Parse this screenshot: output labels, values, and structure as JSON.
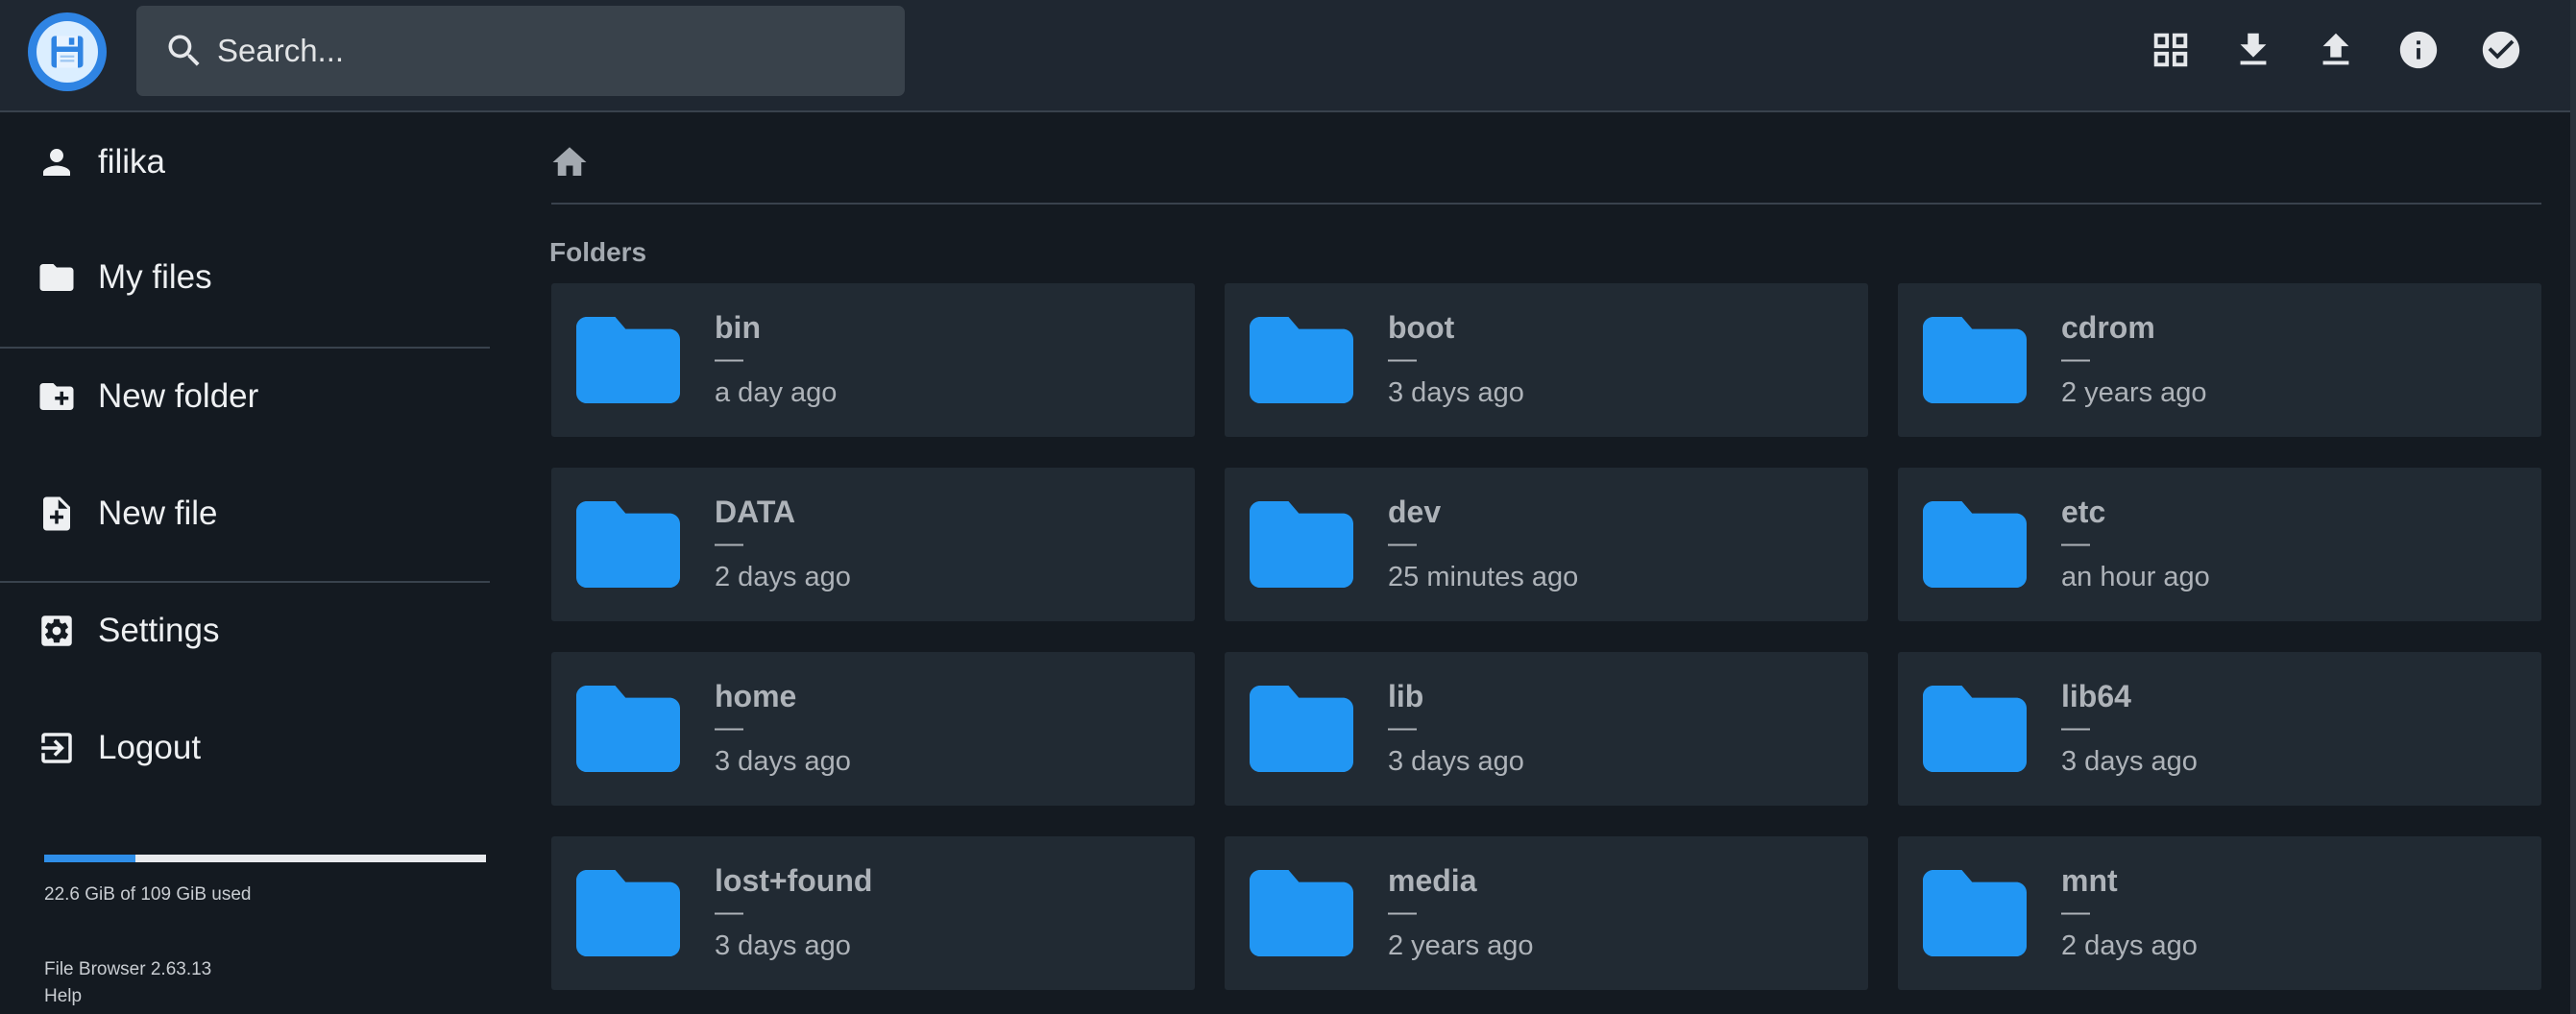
{
  "app": {
    "logo_icon": "floppy-disk-icon"
  },
  "search": {
    "placeholder": "Search..."
  },
  "header_actions": [
    {
      "name": "grid-view-icon",
      "label": "Switch view"
    },
    {
      "name": "download-icon",
      "label": "Download"
    },
    {
      "name": "upload-icon",
      "label": "Upload"
    },
    {
      "name": "info-icon",
      "label": "Info"
    },
    {
      "name": "select-check-icon",
      "label": "Select multiple"
    }
  ],
  "sidebar": {
    "user": "filika",
    "my_files": "My files",
    "new_folder": "New folder",
    "new_file": "New file",
    "settings": "Settings",
    "logout": "Logout",
    "usage_text": "22.6 GiB of 109 GiB used",
    "usage_fraction": 0.207,
    "version": "File Browser 2.63.13",
    "help": "Help"
  },
  "main": {
    "section_title": "Folders",
    "folders": [
      {
        "name": "bin",
        "size": "—",
        "modified": "a day ago"
      },
      {
        "name": "boot",
        "size": "—",
        "modified": "3 days ago"
      },
      {
        "name": "cdrom",
        "size": "—",
        "modified": "2 years ago"
      },
      {
        "name": "DATA",
        "size": "—",
        "modified": "2 days ago"
      },
      {
        "name": "dev",
        "size": "—",
        "modified": "25 minutes ago"
      },
      {
        "name": "etc",
        "size": "—",
        "modified": "an hour ago"
      },
      {
        "name": "home",
        "size": "—",
        "modified": "3 days ago"
      },
      {
        "name": "lib",
        "size": "—",
        "modified": "3 days ago"
      },
      {
        "name": "lib64",
        "size": "—",
        "modified": "3 days ago"
      },
      {
        "name": "lost+found",
        "size": "—",
        "modified": "3 days ago"
      },
      {
        "name": "media",
        "size": "—",
        "modified": "2 years ago"
      },
      {
        "name": "mnt",
        "size": "—",
        "modified": "2 days ago"
      }
    ]
  },
  "colors": {
    "background": "#141a21",
    "header": "#1f2731",
    "card": "#212a33",
    "folder": "#2196f3",
    "accent": "#2f8ee8"
  }
}
